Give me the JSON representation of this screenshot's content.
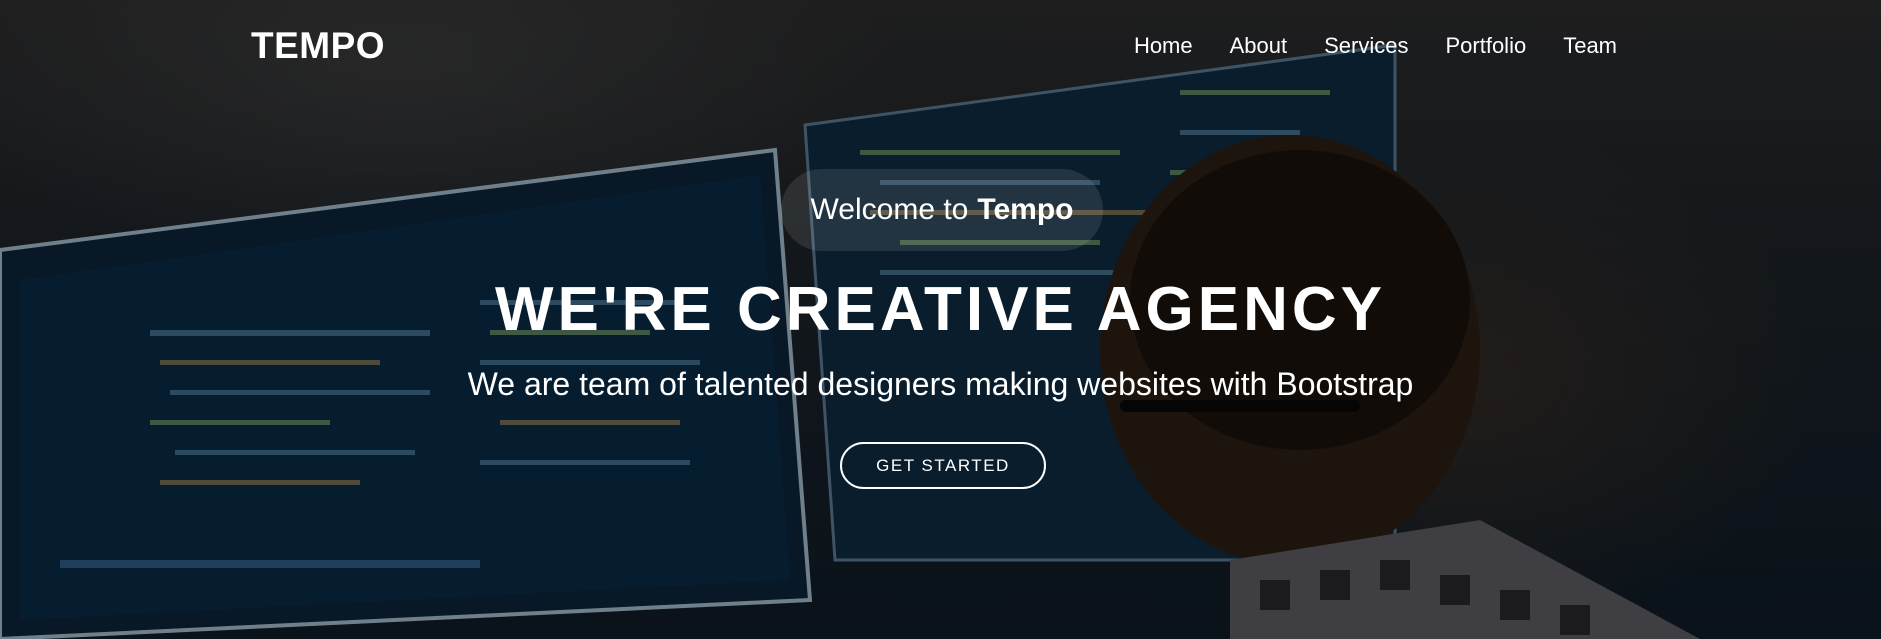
{
  "brand": {
    "logo": "TEMPO"
  },
  "nav": {
    "items": [
      "Home",
      "About",
      "Services",
      "Portfolio",
      "Team"
    ]
  },
  "hero": {
    "welcome_prefix": "Welcome to",
    "welcome_brand": "Tempo",
    "headline": "WE'RE CREATIVE AGENCY",
    "subheadline": "We are team of talented designers making websites with Bootstrap",
    "cta_label": "GET STARTED",
    "background_image": "developer-at-monitors-photo"
  },
  "colors": {
    "text": "#ffffff",
    "overlay": "#000000"
  }
}
